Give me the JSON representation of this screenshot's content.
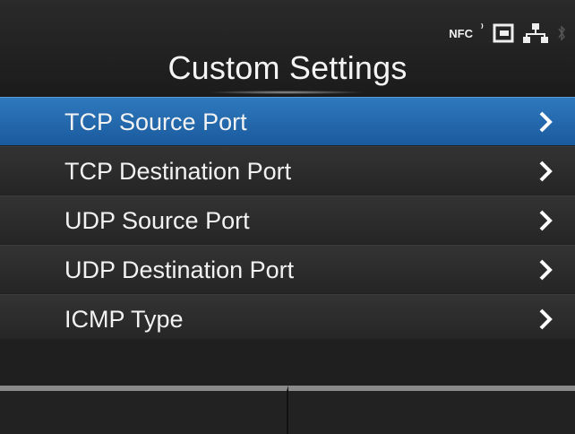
{
  "header": {
    "title": "Custom Settings",
    "status": {
      "nfc_label": "NFC",
      "nfc_waves": "⁾",
      "icons": [
        "nfc-icon",
        "sd-card-icon",
        "network-icon",
        "bluetooth-icon"
      ]
    }
  },
  "menu": {
    "items": [
      {
        "label": "TCP Source Port",
        "selected": true
      },
      {
        "label": "TCP Destination Port",
        "selected": false
      },
      {
        "label": "UDP Source Port",
        "selected": false
      },
      {
        "label": "UDP Destination Port",
        "selected": false
      },
      {
        "label": "ICMP Type",
        "selected": false
      }
    ]
  },
  "colors": {
    "selected": "#2471b5",
    "background": "#202020",
    "text": "#f2f2f2"
  }
}
